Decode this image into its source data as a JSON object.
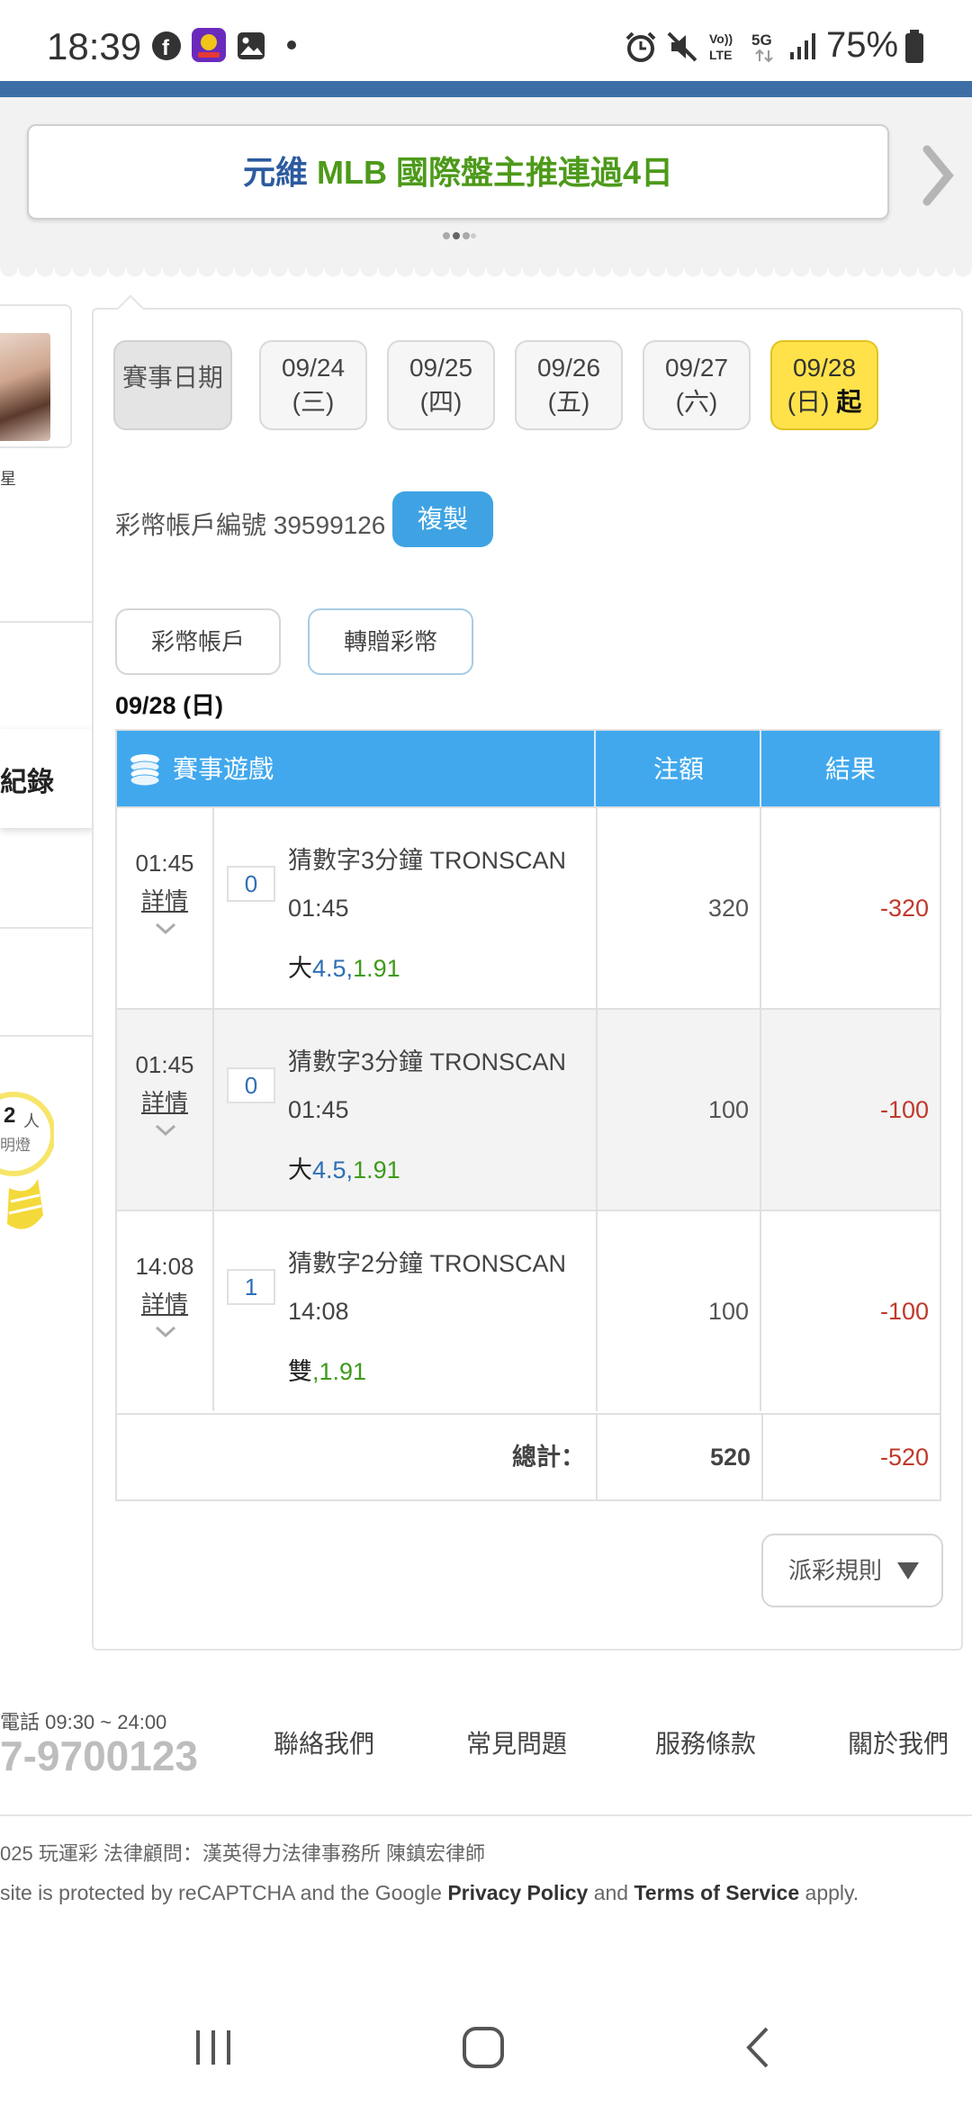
{
  "status_bar": {
    "time": "18:39",
    "battery": "75%",
    "icons": [
      "facebook-icon",
      "app-icon",
      "gallery-icon",
      "dot-icon",
      "alarm-icon",
      "mute-icon",
      "volte-icon",
      "5g-icon",
      "signal-icon",
      "battery-icon"
    ]
  },
  "banner": {
    "part1": "元維 ",
    "part2": "MLB 國際盤主推連過4日",
    "colors": {
      "part1": "#2c5aa0",
      "part2": "#4d9a1a"
    }
  },
  "left_column": {
    "star_char": "星",
    "record_label": "紀錄",
    "bulb_count": "2",
    "bulb_unit": "人",
    "bulb_sub": "明燈"
  },
  "date_picker": {
    "label": "賽事日期",
    "dates": [
      {
        "date": "09/24",
        "weekday": "(三)",
        "suffix": ""
      },
      {
        "date": "09/25",
        "weekday": "(四)",
        "suffix": ""
      },
      {
        "date": "09/26",
        "weekday": "(五)",
        "suffix": ""
      },
      {
        "date": "09/27",
        "weekday": "(六)",
        "suffix": ""
      },
      {
        "date": "09/28",
        "weekday": "(日)",
        "suffix": "起"
      }
    ],
    "active_color": "#ffe24a"
  },
  "account": {
    "label": "彩幣帳戶編號 39599126",
    "copy_button": "複製",
    "wallet_button": "彩幣帳戶",
    "transfer_button": "轉贈彩幣",
    "date_heading": "09/28 (日)"
  },
  "table": {
    "headers": {
      "game": "賽事遊戲",
      "stake": "注額",
      "result": "結果"
    },
    "header_color": "#41a8ee",
    "rows": [
      {
        "time": "01:45",
        "detail": "詳情",
        "number": "0",
        "game": "猜數字3分鐘 TRONSCAN",
        "game_time": "01:45",
        "pick_label": "大",
        "pick_line": "4.5",
        "pick_sep": ",",
        "odds": "1.91",
        "stake": "320",
        "result": "-320"
      },
      {
        "time": "01:45",
        "detail": "詳情",
        "number": "0",
        "game": "猜數字3分鐘 TRONSCAN",
        "game_time": "01:45",
        "pick_label": "大",
        "pick_line": "4.5",
        "pick_sep": ",",
        "odds": "1.91",
        "stake": "100",
        "result": "-100"
      },
      {
        "time": "14:08",
        "detail": "詳情",
        "number": "1",
        "game": "猜數字2分鐘 TRONSCAN",
        "game_time": "14:08",
        "pick_label": "雙",
        "pick_line": "",
        "pick_sep": ",",
        "odds": "1.91",
        "stake": "100",
        "result": "-100"
      }
    ],
    "total_label": "總計：",
    "total_stake": "520",
    "total_result": "-520"
  },
  "rules_button": "派彩規則",
  "footer": {
    "service_hours": "電話 09:30 ~ 24:00",
    "phone": "7-9700123",
    "links": [
      "聯絡我們",
      "常見問題",
      "服務條款",
      "關於我們"
    ],
    "copyright": "025 玩運彩 法律顧問：漢英得力法律事務所 陳鎮宏律師",
    "recaptcha_prefix": "site is protected by reCAPTCHA and the Google ",
    "privacy": "Privacy Policy",
    "and": " and ",
    "terms": "Terms of Service",
    "apply": " apply."
  }
}
